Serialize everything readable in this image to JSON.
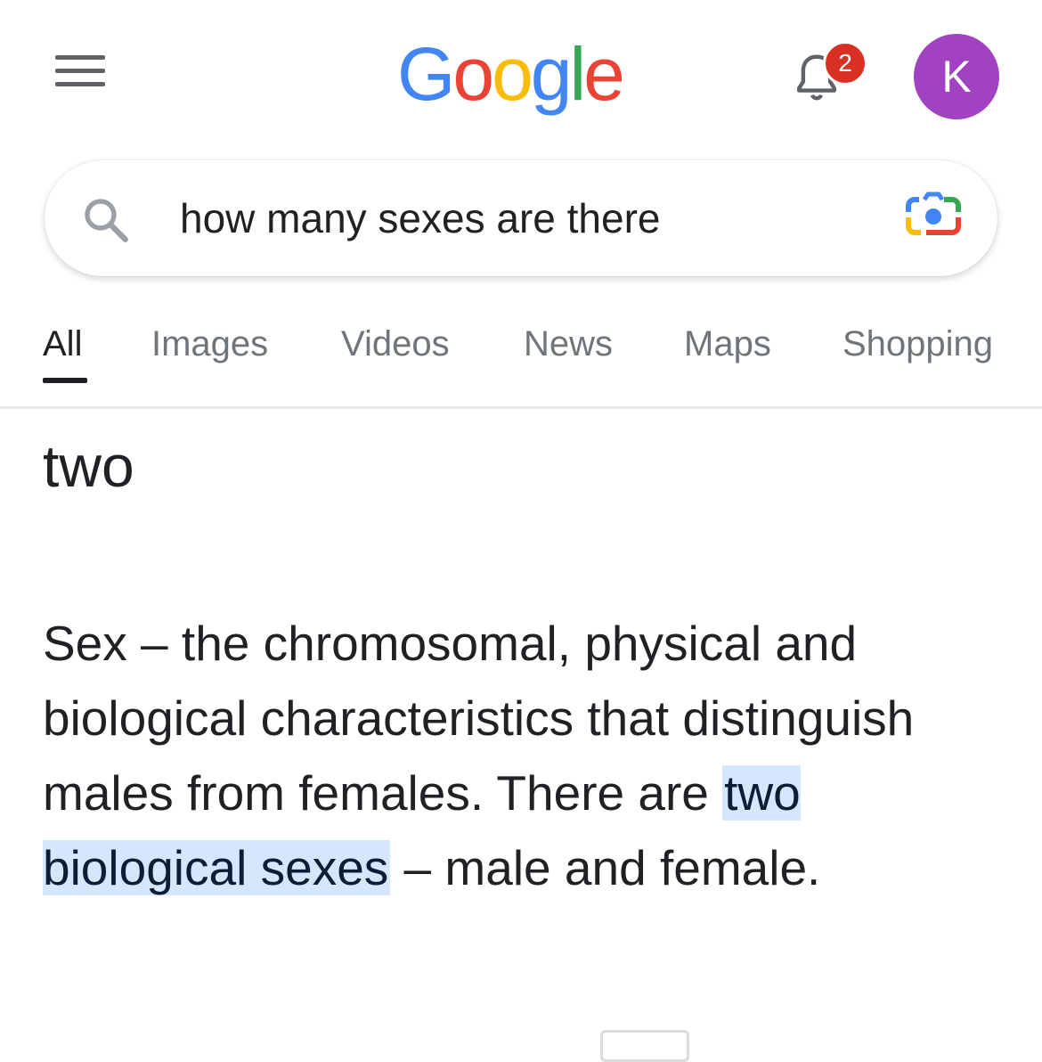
{
  "header": {
    "menu_icon": "hamburger-menu-icon",
    "logo": [
      "G",
      "o",
      "o",
      "g",
      "l",
      "e"
    ],
    "notifications": {
      "icon": "bell-icon",
      "count": "2"
    },
    "avatar_letter": "K"
  },
  "search": {
    "icon": "search-icon",
    "query": "how many sexes are there",
    "lens_icon": "google-lens-camera-icon"
  },
  "tabs": [
    {
      "label": "All",
      "active": true
    },
    {
      "label": "Images"
    },
    {
      "label": "Videos"
    },
    {
      "label": "News"
    },
    {
      "label": "Maps"
    },
    {
      "label": "Shopping"
    }
  ],
  "result": {
    "answer": "two",
    "snippet_before": "Sex – the chromosomal, physical and biological characteristics that distinguish males from females. There are ",
    "snippet_highlight": "two biological sexes",
    "snippet_after": " – male and female."
  },
  "colors": {
    "google_blue": "#4285f4",
    "google_red": "#ea4335",
    "google_yellow": "#fbbc05",
    "google_green": "#34a853",
    "avatar_bg": "#a142c0",
    "badge_bg": "#d93025",
    "highlight_bg": "#d6e6fd"
  }
}
